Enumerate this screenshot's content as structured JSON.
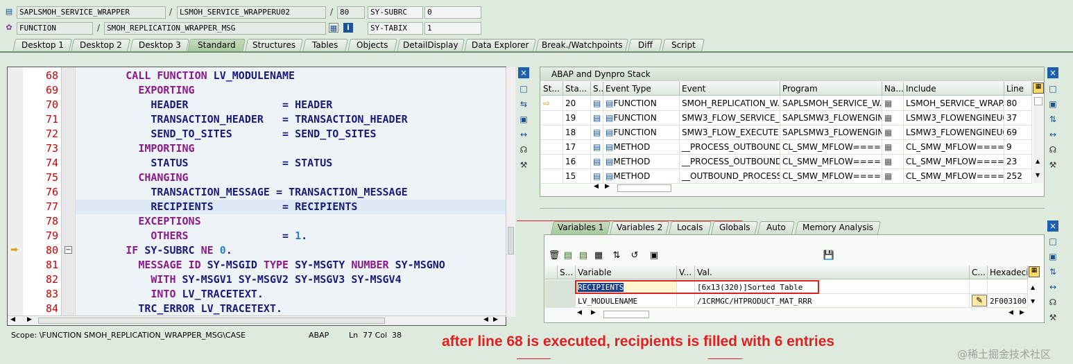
{
  "header": {
    "row1": {
      "program": "SAPLSMOH_SERVICE_WRAPPER",
      "sep": "/",
      "include": "LSMOH_SERVICE_WRAPPERU02",
      "sep2": "/",
      "line": "80",
      "sysfield": "SY-SUBRC",
      "sysvalue": "0"
    },
    "row2": {
      "type": "FUNCTION",
      "sep": "/",
      "name": "SMOH_REPLICATION_WRAPPER_MSG",
      "sysfield": "SY-TABIX",
      "sysvalue": "1"
    }
  },
  "tabs": [
    "Desktop 1",
    "Desktop 2",
    "Desktop 3",
    "Standard",
    "Structures",
    "Tables",
    "Objects",
    "DetailDisplay",
    "Data Explorer",
    "Break./Watchpoints",
    "Diff",
    "Script"
  ],
  "active_tab": "Standard",
  "editor": {
    "lines": [
      {
        "n": "68",
        "parts": [
          {
            "t": "        "
          },
          {
            "t": "CALL FUNCTION",
            "c": "kw"
          },
          {
            "t": " LV_MODULENAME"
          }
        ]
      },
      {
        "n": "69",
        "parts": [
          {
            "t": "          "
          },
          {
            "t": "EXPORTING",
            "c": "kw"
          }
        ]
      },
      {
        "n": "70",
        "parts": [
          {
            "t": "            HEADER               = HEADER"
          }
        ]
      },
      {
        "n": "71",
        "parts": [
          {
            "t": "            TRANSACTION_HEADER   = TRANSACTION_HEADER"
          }
        ]
      },
      {
        "n": "72",
        "parts": [
          {
            "t": "            SEND_TO_SITES        = SEND_TO_SITES"
          }
        ]
      },
      {
        "n": "73",
        "parts": [
          {
            "t": "          "
          },
          {
            "t": "IMPORTING",
            "c": "kw"
          }
        ]
      },
      {
        "n": "74",
        "parts": [
          {
            "t": "            STATUS               = STATUS"
          }
        ]
      },
      {
        "n": "75",
        "parts": [
          {
            "t": "          "
          },
          {
            "t": "CHANGING",
            "c": "kw"
          }
        ]
      },
      {
        "n": "76",
        "parts": [
          {
            "t": "            TRANSACTION_MESSAGE = TRANSACTION_MESSAGE"
          }
        ]
      },
      {
        "n": "77",
        "parts": [
          {
            "t": "            RECIPIENTS           = RECIPIENTS"
          }
        ],
        "highlight": true
      },
      {
        "n": "78",
        "parts": [
          {
            "t": "          "
          },
          {
            "t": "EXCEPTIONS",
            "c": "kw"
          }
        ]
      },
      {
        "n": "79",
        "parts": [
          {
            "t": "            "
          },
          {
            "t": "OTHERS",
            "c": "kw"
          },
          {
            "t": "               = "
          },
          {
            "t": "1",
            "c": "num"
          },
          {
            "t": "."
          }
        ]
      },
      {
        "n": "80",
        "parts": [
          {
            "t": "        "
          },
          {
            "t": "IF",
            "c": "kw"
          },
          {
            "t": " SY-SUBRC "
          },
          {
            "t": "NE",
            "c": "kw"
          },
          {
            "t": " "
          },
          {
            "t": "0",
            "c": "num"
          },
          {
            "t": "."
          }
        ],
        "current": true
      },
      {
        "n": "81",
        "parts": [
          {
            "t": "          "
          },
          {
            "t": "MESSAGE ID",
            "c": "kw"
          },
          {
            "t": " SY-MSGID "
          },
          {
            "t": "TYPE",
            "c": "kw"
          },
          {
            "t": " SY-MSGTY "
          },
          {
            "t": "NUMBER",
            "c": "kw"
          },
          {
            "t": " SY-MSGNO"
          }
        ]
      },
      {
        "n": "82",
        "parts": [
          {
            "t": "            "
          },
          {
            "t": "WITH",
            "c": "kw"
          },
          {
            "t": " SY-MSGV1 SY-MSGV2 SY-MSGV3 SY-MSGV4"
          }
        ]
      },
      {
        "n": "83",
        "parts": [
          {
            "t": "            "
          },
          {
            "t": "INTO",
            "c": "kw"
          },
          {
            "t": " LV_TRACETEXT."
          }
        ]
      },
      {
        "n": "84",
        "parts": [
          {
            "t": "          TRC_ERROR LV_TRACETEXT."
          }
        ]
      }
    ]
  },
  "status": {
    "scope": "Scope: \\FUNCTION SMOH_REPLICATION_WRAPPER_MSG\\CASE",
    "lang": "ABAP",
    "pos": "Ln  77 Col  38"
  },
  "stack": {
    "title": "ABAP and Dynpro Stack",
    "columns": [
      "St...",
      "Sta...",
      "S...",
      "Event Type",
      "Event",
      "Program",
      "Na...",
      "Include",
      "Line"
    ],
    "rows": [
      {
        "stack": "20",
        "etype": "FUNCTION",
        "event": "SMOH_REPLICATION_W...",
        "program": "SAPLSMOH_SERVICE_W...",
        "include": "LSMOH_SERVICE_WRAP...",
        "line": "80",
        "current": true
      },
      {
        "stack": "19",
        "etype": "FUNCTION",
        "event": "SMW3_FLOW_SERVICE_...",
        "program": "SAPLSMW3_FLOWENGIN...",
        "include": "LSMW3_FLOWENGINEU0...",
        "line": "37"
      },
      {
        "stack": "18",
        "etype": "FUNCTION",
        "event": "SMW3_FLOW_EXECUTE",
        "program": "SAPLSMW3_FLOWENGIN...",
        "include": "LSMW3_FLOWENGINEU0...",
        "line": "69"
      },
      {
        "stack": "17",
        "etype": "METHOD",
        "event": "__PROCESS_OUTBOUND_...",
        "program": "CL_SMW_MFLOW=====...",
        "include": "CL_SMW_MFLOW=====...",
        "line": "9"
      },
      {
        "stack": "16",
        "etype": "METHOD",
        "event": "__PROCESS_OUTBOUND",
        "program": "CL_SMW_MFLOW=====...",
        "include": "CL_SMW_MFLOW=====...",
        "line": "23"
      },
      {
        "stack": "15",
        "etype": "METHOD",
        "event": "__OUTBOUND_PROCESS...",
        "program": "CL_SMW_MFLOW=====...",
        "include": "CL_SMW_MFLOW=====...",
        "line": "252"
      }
    ]
  },
  "vartabs": [
    "Variables 1",
    "Variables 2",
    "Locals",
    "Globals",
    "Auto",
    "Memory Analysis"
  ],
  "vars": {
    "columns": [
      "S...",
      "Variable",
      "V...",
      "Val.",
      "C...",
      "Hexadecir"
    ],
    "rows": [
      {
        "name": "RECIPIENTS",
        "value": "[6x13(320)]Sorted Table",
        "hex": ""
      },
      {
        "name": "LV_MODULENAME",
        "value": "/1CRMGC/HTPRODUCT_MAT_RRR",
        "hex": "2F003100"
      }
    ]
  },
  "annotation": "after line 68 is executed, recipients is filled with 6 entries",
  "watermark": "@稀土掘金技术社区"
}
